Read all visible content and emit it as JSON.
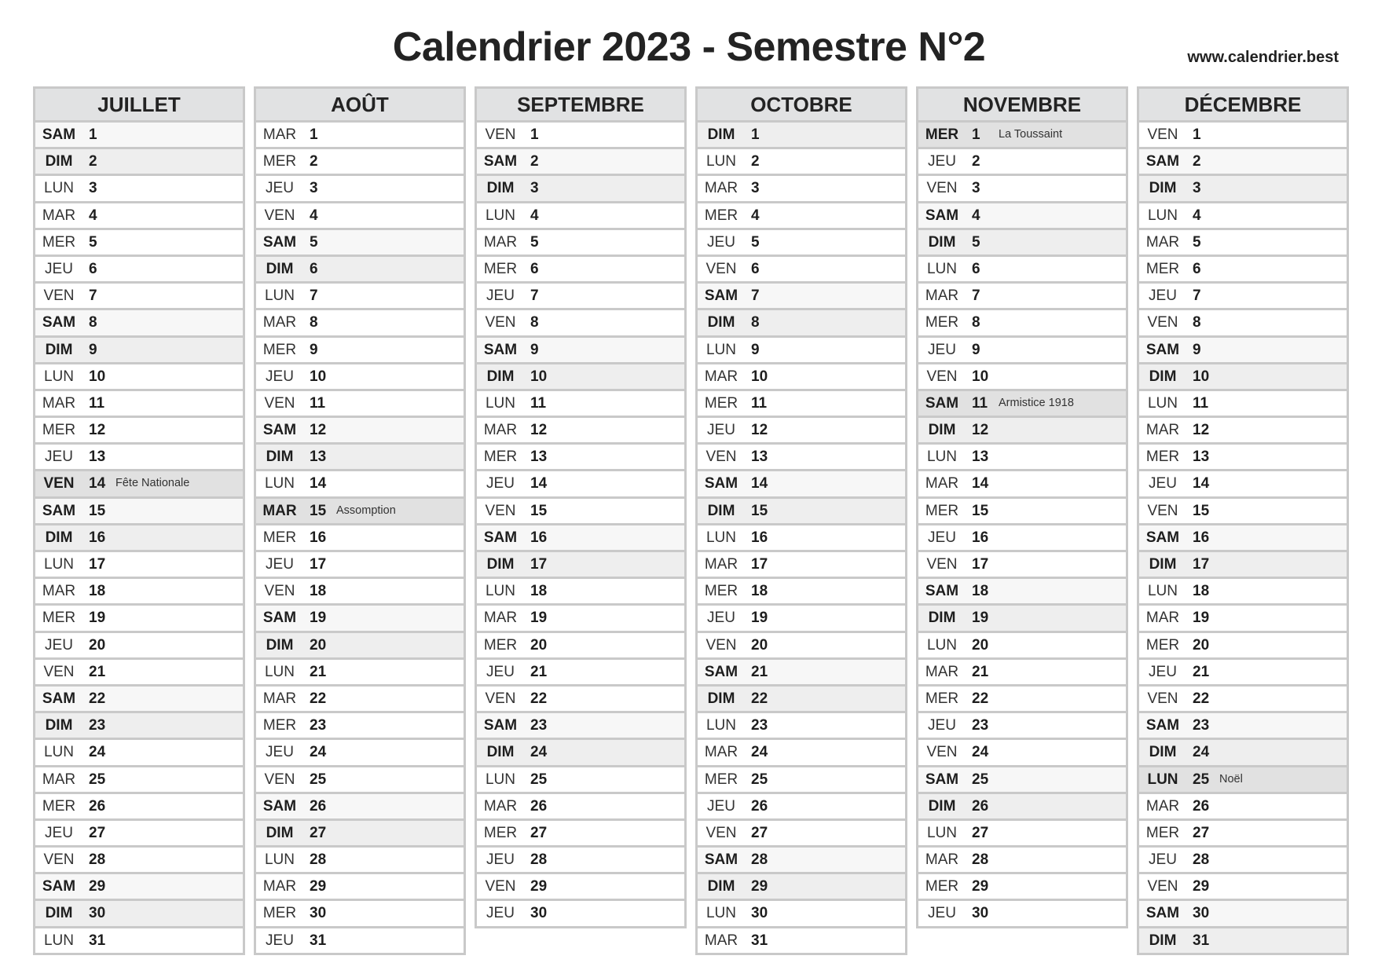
{
  "header": {
    "title": "Calendrier 2023 - Semestre N°2",
    "website": "www.calendrier.best"
  },
  "colors": {
    "header_bg": "#e1e2e3",
    "border": "#c9c9c9",
    "saturday_bg": "#f7f7f7",
    "sunday_bg": "#eeeeee",
    "holiday_bg": "#e1e1e1",
    "text": "#222222"
  },
  "months": [
    {
      "name": "JUILLET",
      "days": [
        {
          "wd": "SAM",
          "d": "1"
        },
        {
          "wd": "DIM",
          "d": "2"
        },
        {
          "wd": "LUN",
          "d": "3"
        },
        {
          "wd": "MAR",
          "d": "4"
        },
        {
          "wd": "MER",
          "d": "5"
        },
        {
          "wd": "JEU",
          "d": "6"
        },
        {
          "wd": "VEN",
          "d": "7"
        },
        {
          "wd": "SAM",
          "d": "8"
        },
        {
          "wd": "DIM",
          "d": "9"
        },
        {
          "wd": "LUN",
          "d": "10"
        },
        {
          "wd": "MAR",
          "d": "11"
        },
        {
          "wd": "MER",
          "d": "12"
        },
        {
          "wd": "JEU",
          "d": "13"
        },
        {
          "wd": "VEN",
          "d": "14",
          "holiday": "Fête Nationale"
        },
        {
          "wd": "SAM",
          "d": "15"
        },
        {
          "wd": "DIM",
          "d": "16"
        },
        {
          "wd": "LUN",
          "d": "17"
        },
        {
          "wd": "MAR",
          "d": "18"
        },
        {
          "wd": "MER",
          "d": "19"
        },
        {
          "wd": "JEU",
          "d": "20"
        },
        {
          "wd": "VEN",
          "d": "21"
        },
        {
          "wd": "SAM",
          "d": "22"
        },
        {
          "wd": "DIM",
          "d": "23"
        },
        {
          "wd": "LUN",
          "d": "24"
        },
        {
          "wd": "MAR",
          "d": "25"
        },
        {
          "wd": "MER",
          "d": "26"
        },
        {
          "wd": "JEU",
          "d": "27"
        },
        {
          "wd": "VEN",
          "d": "28"
        },
        {
          "wd": "SAM",
          "d": "29"
        },
        {
          "wd": "DIM",
          "d": "30"
        },
        {
          "wd": "LUN",
          "d": "31"
        }
      ]
    },
    {
      "name": "AOÛT",
      "days": [
        {
          "wd": "MAR",
          "d": "1"
        },
        {
          "wd": "MER",
          "d": "2"
        },
        {
          "wd": "JEU",
          "d": "3"
        },
        {
          "wd": "VEN",
          "d": "4"
        },
        {
          "wd": "SAM",
          "d": "5"
        },
        {
          "wd": "DIM",
          "d": "6"
        },
        {
          "wd": "LUN",
          "d": "7"
        },
        {
          "wd": "MAR",
          "d": "8"
        },
        {
          "wd": "MER",
          "d": "9"
        },
        {
          "wd": "JEU",
          "d": "10"
        },
        {
          "wd": "VEN",
          "d": "11"
        },
        {
          "wd": "SAM",
          "d": "12"
        },
        {
          "wd": "DIM",
          "d": "13"
        },
        {
          "wd": "LUN",
          "d": "14"
        },
        {
          "wd": "MAR",
          "d": "15",
          "holiday": "Assomption"
        },
        {
          "wd": "MER",
          "d": "16"
        },
        {
          "wd": "JEU",
          "d": "17"
        },
        {
          "wd": "VEN",
          "d": "18"
        },
        {
          "wd": "SAM",
          "d": "19"
        },
        {
          "wd": "DIM",
          "d": "20"
        },
        {
          "wd": "LUN",
          "d": "21"
        },
        {
          "wd": "MAR",
          "d": "22"
        },
        {
          "wd": "MER",
          "d": "23"
        },
        {
          "wd": "JEU",
          "d": "24"
        },
        {
          "wd": "VEN",
          "d": "25"
        },
        {
          "wd": "SAM",
          "d": "26"
        },
        {
          "wd": "DIM",
          "d": "27"
        },
        {
          "wd": "LUN",
          "d": "28"
        },
        {
          "wd": "MAR",
          "d": "29"
        },
        {
          "wd": "MER",
          "d": "30"
        },
        {
          "wd": "JEU",
          "d": "31"
        }
      ]
    },
    {
      "name": "SEPTEMBRE",
      "days": [
        {
          "wd": "VEN",
          "d": "1"
        },
        {
          "wd": "SAM",
          "d": "2"
        },
        {
          "wd": "DIM",
          "d": "3"
        },
        {
          "wd": "LUN",
          "d": "4"
        },
        {
          "wd": "MAR",
          "d": "5"
        },
        {
          "wd": "MER",
          "d": "6"
        },
        {
          "wd": "JEU",
          "d": "7"
        },
        {
          "wd": "VEN",
          "d": "8"
        },
        {
          "wd": "SAM",
          "d": "9"
        },
        {
          "wd": "DIM",
          "d": "10"
        },
        {
          "wd": "LUN",
          "d": "11"
        },
        {
          "wd": "MAR",
          "d": "12"
        },
        {
          "wd": "MER",
          "d": "13"
        },
        {
          "wd": "JEU",
          "d": "14"
        },
        {
          "wd": "VEN",
          "d": "15"
        },
        {
          "wd": "SAM",
          "d": "16"
        },
        {
          "wd": "DIM",
          "d": "17"
        },
        {
          "wd": "LUN",
          "d": "18"
        },
        {
          "wd": "MAR",
          "d": "19"
        },
        {
          "wd": "MER",
          "d": "20"
        },
        {
          "wd": "JEU",
          "d": "21"
        },
        {
          "wd": "VEN",
          "d": "22"
        },
        {
          "wd": "SAM",
          "d": "23"
        },
        {
          "wd": "DIM",
          "d": "24"
        },
        {
          "wd": "LUN",
          "d": "25"
        },
        {
          "wd": "MAR",
          "d": "26"
        },
        {
          "wd": "MER",
          "d": "27"
        },
        {
          "wd": "JEU",
          "d": "28"
        },
        {
          "wd": "VEN",
          "d": "29"
        },
        {
          "wd": "JEU",
          "d": "30"
        }
      ]
    },
    {
      "name": "OCTOBRE",
      "days": [
        {
          "wd": "DIM",
          "d": "1"
        },
        {
          "wd": "LUN",
          "d": "2"
        },
        {
          "wd": "MAR",
          "d": "3"
        },
        {
          "wd": "MER",
          "d": "4"
        },
        {
          "wd": "JEU",
          "d": "5"
        },
        {
          "wd": "VEN",
          "d": "6"
        },
        {
          "wd": "SAM",
          "d": "7"
        },
        {
          "wd": "DIM",
          "d": "8"
        },
        {
          "wd": "LUN",
          "d": "9"
        },
        {
          "wd": "MAR",
          "d": "10"
        },
        {
          "wd": "MER",
          "d": "11"
        },
        {
          "wd": "JEU",
          "d": "12"
        },
        {
          "wd": "VEN",
          "d": "13"
        },
        {
          "wd": "SAM",
          "d": "14"
        },
        {
          "wd": "DIM",
          "d": "15"
        },
        {
          "wd": "LUN",
          "d": "16"
        },
        {
          "wd": "MAR",
          "d": "17"
        },
        {
          "wd": "MER",
          "d": "18"
        },
        {
          "wd": "JEU",
          "d": "19"
        },
        {
          "wd": "VEN",
          "d": "20"
        },
        {
          "wd": "SAM",
          "d": "21"
        },
        {
          "wd": "DIM",
          "d": "22"
        },
        {
          "wd": "LUN",
          "d": "23"
        },
        {
          "wd": "MAR",
          "d": "24"
        },
        {
          "wd": "MER",
          "d": "25"
        },
        {
          "wd": "JEU",
          "d": "26"
        },
        {
          "wd": "VEN",
          "d": "27"
        },
        {
          "wd": "SAM",
          "d": "28"
        },
        {
          "wd": "DIM",
          "d": "29"
        },
        {
          "wd": "LUN",
          "d": "30"
        },
        {
          "wd": "MAR",
          "d": "31"
        }
      ]
    },
    {
      "name": "NOVEMBRE",
      "days": [
        {
          "wd": "MER",
          "d": "1",
          "holiday": "La Toussaint"
        },
        {
          "wd": "JEU",
          "d": "2"
        },
        {
          "wd": "VEN",
          "d": "3"
        },
        {
          "wd": "SAM",
          "d": "4"
        },
        {
          "wd": "DIM",
          "d": "5"
        },
        {
          "wd": "LUN",
          "d": "6"
        },
        {
          "wd": "MAR",
          "d": "7"
        },
        {
          "wd": "MER",
          "d": "8"
        },
        {
          "wd": "JEU",
          "d": "9"
        },
        {
          "wd": "VEN",
          "d": "10"
        },
        {
          "wd": "SAM",
          "d": "11",
          "holiday": "Armistice 1918"
        },
        {
          "wd": "DIM",
          "d": "12"
        },
        {
          "wd": "LUN",
          "d": "13"
        },
        {
          "wd": "MAR",
          "d": "14"
        },
        {
          "wd": "MER",
          "d": "15"
        },
        {
          "wd": "JEU",
          "d": "16"
        },
        {
          "wd": "VEN",
          "d": "17"
        },
        {
          "wd": "SAM",
          "d": "18"
        },
        {
          "wd": "DIM",
          "d": "19"
        },
        {
          "wd": "LUN",
          "d": "20"
        },
        {
          "wd": "MAR",
          "d": "21"
        },
        {
          "wd": "MER",
          "d": "22"
        },
        {
          "wd": "JEU",
          "d": "23"
        },
        {
          "wd": "VEN",
          "d": "24"
        },
        {
          "wd": "SAM",
          "d": "25"
        },
        {
          "wd": "DIM",
          "d": "26"
        },
        {
          "wd": "LUN",
          "d": "27"
        },
        {
          "wd": "MAR",
          "d": "28"
        },
        {
          "wd": "MER",
          "d": "29"
        },
        {
          "wd": "JEU",
          "d": "30"
        }
      ]
    },
    {
      "name": "DÉCEMBRE",
      "days": [
        {
          "wd": "VEN",
          "d": "1"
        },
        {
          "wd": "SAM",
          "d": "2"
        },
        {
          "wd": "DIM",
          "d": "3"
        },
        {
          "wd": "LUN",
          "d": "4"
        },
        {
          "wd": "MAR",
          "d": "5"
        },
        {
          "wd": "MER",
          "d": "6"
        },
        {
          "wd": "JEU",
          "d": "7"
        },
        {
          "wd": "VEN",
          "d": "8"
        },
        {
          "wd": "SAM",
          "d": "9"
        },
        {
          "wd": "DIM",
          "d": "10"
        },
        {
          "wd": "LUN",
          "d": "11"
        },
        {
          "wd": "MAR",
          "d": "12"
        },
        {
          "wd": "MER",
          "d": "13"
        },
        {
          "wd": "JEU",
          "d": "14"
        },
        {
          "wd": "VEN",
          "d": "15"
        },
        {
          "wd": "SAM",
          "d": "16"
        },
        {
          "wd": "DIM",
          "d": "17"
        },
        {
          "wd": "LUN",
          "d": "18"
        },
        {
          "wd": "MAR",
          "d": "19"
        },
        {
          "wd": "MER",
          "d": "20"
        },
        {
          "wd": "JEU",
          "d": "21"
        },
        {
          "wd": "VEN",
          "d": "22"
        },
        {
          "wd": "SAM",
          "d": "23"
        },
        {
          "wd": "DIM",
          "d": "24"
        },
        {
          "wd": "LUN",
          "d": "25",
          "holiday": "Noël"
        },
        {
          "wd": "MAR",
          "d": "26"
        },
        {
          "wd": "MER",
          "d": "27"
        },
        {
          "wd": "JEU",
          "d": "28"
        },
        {
          "wd": "VEN",
          "d": "29"
        },
        {
          "wd": "SAM",
          "d": "30"
        },
        {
          "wd": "DIM",
          "d": "31"
        }
      ]
    }
  ]
}
